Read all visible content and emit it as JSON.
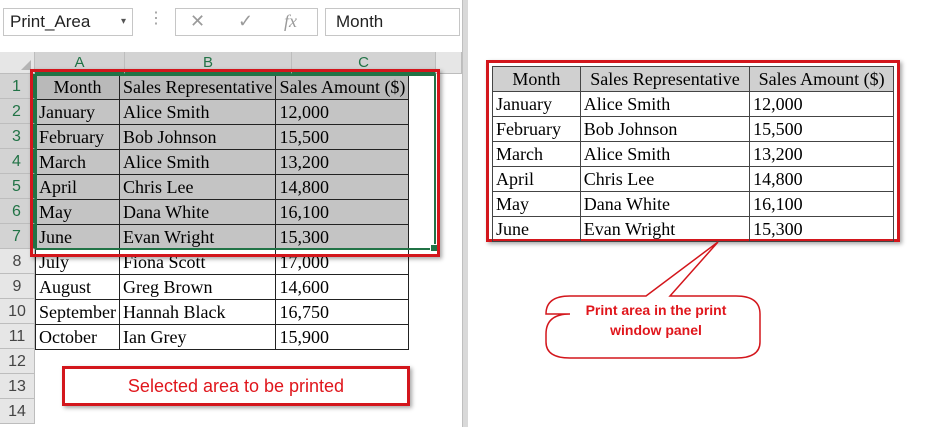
{
  "formula_bar": {
    "name_box": "Print_Area",
    "name_box_dropdown": "▾",
    "cancel_icon": "✕",
    "enter_icon": "✓",
    "function_icon": "fx",
    "formula_value": "Month"
  },
  "sheet": {
    "column_headers": [
      "A",
      "B",
      "C"
    ],
    "row_numbers": [
      "1",
      "2",
      "3",
      "4",
      "5",
      "6",
      "7",
      "8",
      "9",
      "10",
      "11",
      "12",
      "13",
      "14"
    ],
    "header": [
      "Month",
      "Sales Representative",
      "Sales Amount ($)"
    ],
    "rows": [
      [
        "January",
        "Alice Smith",
        "12,000"
      ],
      [
        "February",
        "Bob Johnson",
        "15,500"
      ],
      [
        "March",
        "Alice Smith",
        "13,200"
      ],
      [
        "April",
        "Chris Lee",
        "14,800"
      ],
      [
        "May",
        "Dana White",
        "16,100"
      ],
      [
        "June",
        "Evan Wright",
        "15,300"
      ],
      [
        "July",
        "Fiona Scott",
        "17,000"
      ],
      [
        "August",
        "Greg Brown",
        "14,600"
      ],
      [
        "September",
        "Hannah Black",
        "16,750"
      ],
      [
        "October",
        "Ian Grey",
        "15,900"
      ]
    ],
    "selected_row_count": 7
  },
  "annotations": {
    "selected_area": "Selected area to be printed",
    "print_area_callout_line1": "Print area in the print",
    "print_area_callout_line2": "window panel"
  },
  "print_preview": {
    "header": [
      "Month",
      "Sales Representative",
      "Sales Amount ($)"
    ],
    "rows": [
      [
        "January",
        "Alice Smith",
        "12,000"
      ],
      [
        "February",
        "Bob Johnson",
        "15,500"
      ],
      [
        "March",
        "Alice Smith",
        "13,200"
      ],
      [
        "April",
        "Chris Lee",
        "14,800"
      ],
      [
        "May",
        "Dana White",
        "16,100"
      ],
      [
        "June",
        "Evan Wright",
        "15,300"
      ]
    ]
  },
  "colors": {
    "highlight_red": "#d3161c",
    "excel_green": "#217346",
    "selection_gray": "#c4c4c4"
  }
}
